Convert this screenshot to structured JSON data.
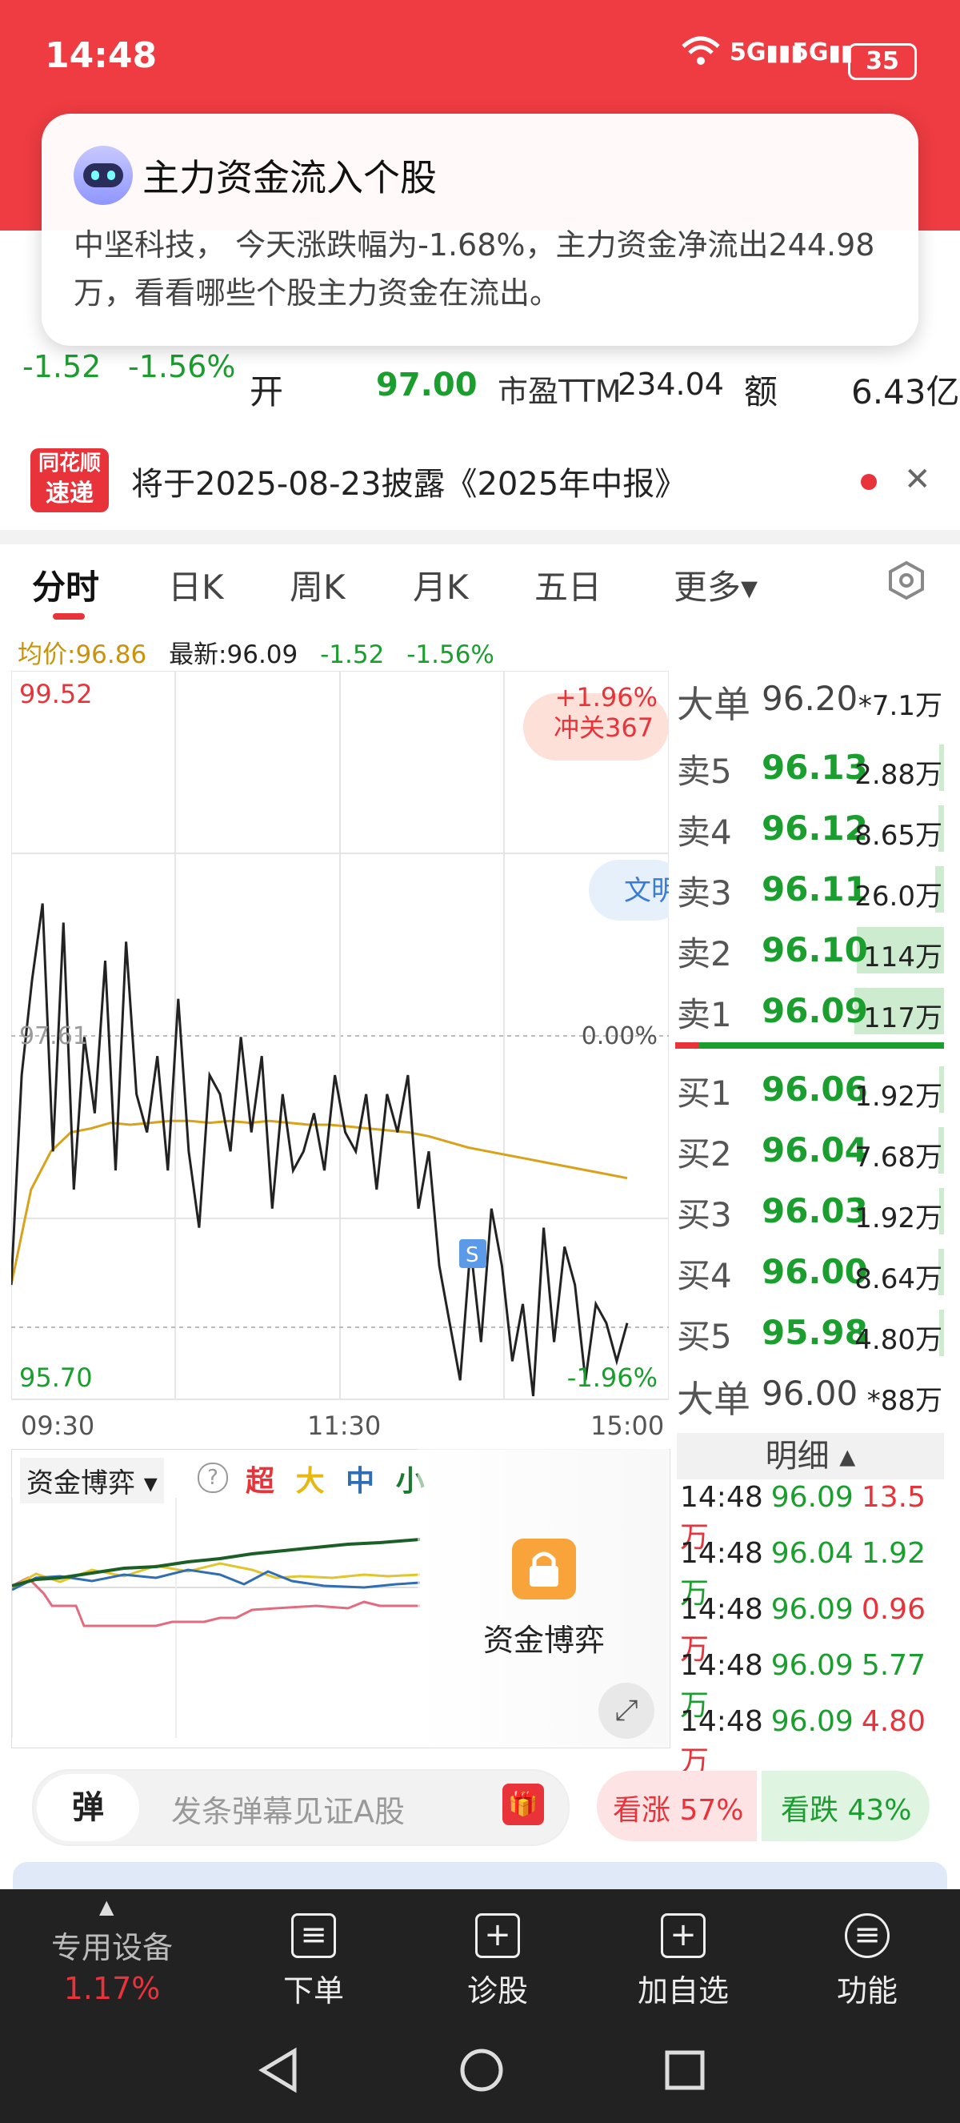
{
  "status_bar": {
    "time": "14:48",
    "network1": "5G",
    "network2": "5G",
    "battery": "35"
  },
  "notification": {
    "title": "主力资金流入个股",
    "body": "中坚科技， 今天涨跌幅为-1.68%，主力资金净流出244.98万，看看哪些个股主力资金在流出。"
  },
  "quote": {
    "change": "-1.52",
    "change_pct": "-1.56%",
    "open_label": "开",
    "open_value": "97.00",
    "pe_label": "市盈TTM",
    "pe_value": "234.04",
    "amount_label": "额",
    "amount_value": "6.43亿"
  },
  "banner": {
    "logo_top": "同花顺",
    "logo_bottom": "速递",
    "text": "将于2025-08-23披露《2025年中报》"
  },
  "tabs": [
    "分时",
    "日K",
    "周K",
    "月K",
    "五日",
    "更多▾"
  ],
  "chart_info": {
    "avg": "均价:96.86",
    "latest": "最新:96.09",
    "chg": "-1.52",
    "pct": "-1.56%"
  },
  "chart_data": {
    "type": "line",
    "y_top_label": "99.52",
    "y_mid_label": "97.61",
    "y_bottom_label": "95.70",
    "pct_top": "+1.96%",
    "pct_mid": "0.00%",
    "pct_bottom": "-1.96%",
    "x_labels": [
      "09:30",
      "11:30",
      "15:00"
    ],
    "ylim": [
      95.7,
      99.52
    ],
    "series": [
      {
        "values": [
          96.3,
          97.4,
          97.9,
          98.3,
          97.0,
          98.2,
          96.8,
          97.6,
          97.2,
          98.0,
          96.9,
          98.1,
          97.3,
          97.1,
          97.5,
          96.9,
          97.8,
          97.0,
          96.6,
          97.4,
          97.3,
          97.0,
          97.6,
          97.1,
          97.5,
          96.7,
          97.3,
          96.9,
          97.0,
          97.2,
          96.9,
          97.4,
          97.1,
          97.0,
          97.3,
          96.8,
          97.3,
          97.1,
          97.4,
          96.7,
          97.0,
          96.4,
          96.1,
          95.8,
          96.5,
          96.0,
          96.7,
          96.4,
          95.9,
          96.2,
          95.7,
          96.6,
          96.0,
          96.5,
          96.3,
          95.8,
          96.2,
          96.1,
          95.9,
          96.1
        ]
      },
      {
        "values": [
          96.3,
          96.8,
          97.0,
          97.1,
          97.12,
          97.15,
          97.14,
          97.15,
          97.16,
          97.16,
          97.15,
          97.16,
          97.15,
          97.16,
          97.15,
          97.14,
          97.14,
          97.13,
          97.12,
          97.11,
          97.1,
          97.08,
          97.05,
          97.02,
          97.0,
          96.98,
          96.96,
          96.94,
          96.92,
          96.9,
          96.88,
          96.86
        ]
      }
    ],
    "notes": [
      "冲关367",
      "文明"
    ]
  },
  "orderbook": {
    "big_sell": {
      "label": "大单",
      "price": "96.20",
      "vol": "*7.1万"
    },
    "asks": [
      {
        "label": "卖5",
        "price": "96.13",
        "vol": "2.88万",
        "bar": 0.02
      },
      {
        "label": "卖4",
        "price": "96.12",
        "vol": "8.65万",
        "bar": 0.06
      },
      {
        "label": "卖3",
        "price": "96.11",
        "vol": "26.0万",
        "bar": 0.1
      },
      {
        "label": "卖2",
        "price": "96.10",
        "vol": "114万",
        "bar": 0.97
      },
      {
        "label": "卖1",
        "price": "96.09",
        "vol": "117万",
        "bar": 1.0
      }
    ],
    "bids": [
      {
        "label": "买1",
        "price": "96.06",
        "vol": "1.92万",
        "bar": 0.02
      },
      {
        "label": "买2",
        "price": "96.04",
        "vol": "7.68万",
        "bar": 0.06
      },
      {
        "label": "买3",
        "price": "96.03",
        "vol": "1.92万",
        "bar": 0.02
      },
      {
        "label": "买4",
        "price": "96.00",
        "vol": "8.64万",
        "bar": 0.06
      },
      {
        "label": "买5",
        "price": "95.98",
        "vol": "4.80万",
        "bar": 0.04
      }
    ],
    "big_buy": {
      "label": "大单",
      "price": "96.00",
      "vol": "*88万"
    }
  },
  "detail": {
    "title": "明细 ▴",
    "trades": [
      {
        "time": "14:48",
        "price": "96.09",
        "vol": "13.5万",
        "side": "sell"
      },
      {
        "time": "14:48",
        "price": "96.04",
        "vol": "1.92万",
        "side": "buy"
      },
      {
        "time": "14:48",
        "price": "96.09",
        "vol": "0.96万",
        "side": "sell"
      },
      {
        "time": "14:48",
        "price": "96.09",
        "vol": "5.77万",
        "side": "buy"
      },
      {
        "time": "14:48",
        "price": "96.09",
        "vol": "4.80万",
        "side": "sell"
      }
    ]
  },
  "capital": {
    "selector": "资金博弈 ▾",
    "help": "?",
    "legend": [
      "超",
      "大",
      "中",
      "小"
    ],
    "overlay_label": "资金博弈"
  },
  "bottom": {
    "danmu_icon": "弹",
    "danmu_placeholder": "发条弹幕见证A股",
    "vote_up": "看涨 57%",
    "vote_down": "看跌 43%"
  },
  "toolbar": {
    "device_label": "专用设备",
    "device_pct": "1.17%",
    "items": [
      "下单",
      "诊股",
      "加自选",
      "功能"
    ]
  },
  "colors": {
    "red": "#e8333b",
    "green": "#1a9e2e",
    "avg_line": "#d9a21b",
    "price_line": "#222222",
    "header": "#ee3c42"
  }
}
